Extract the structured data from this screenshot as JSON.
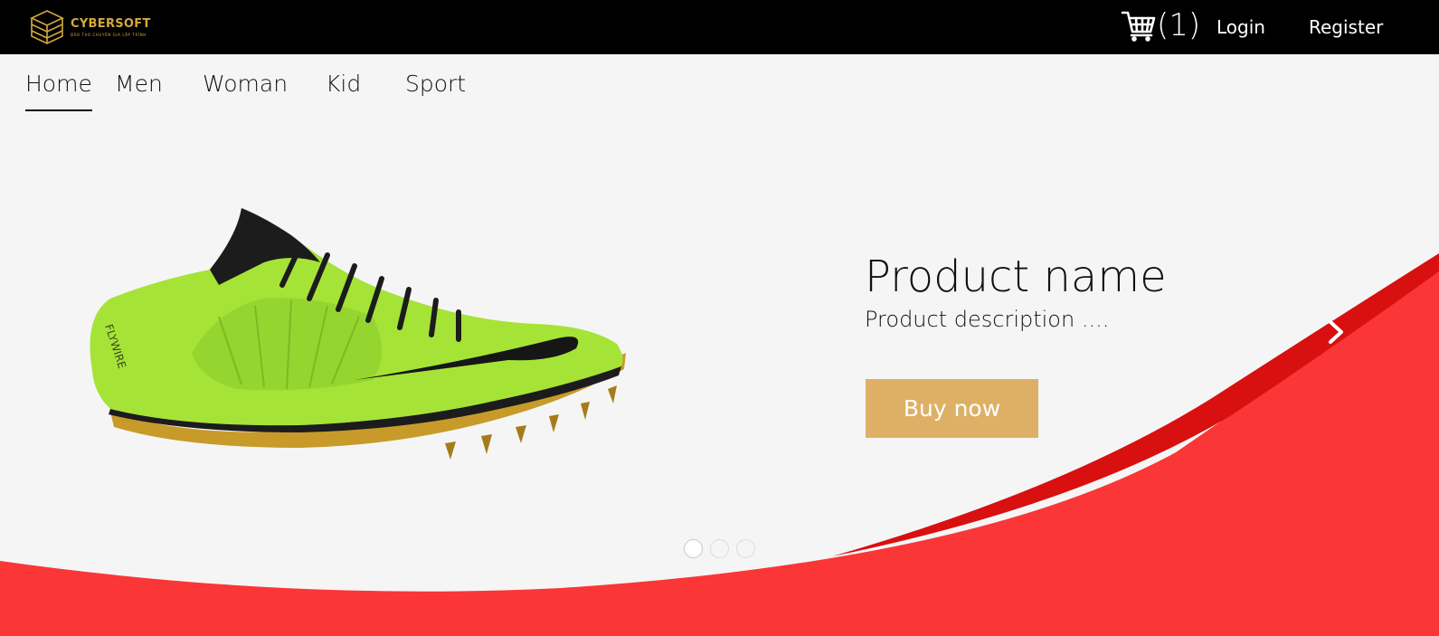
{
  "header": {
    "brand": "CYBERSOFT",
    "tagline": "ĐÀO TẠO CHUYÊN GIA LẬP TRÌNH",
    "cart_count": "(1)",
    "login_label": "Login",
    "register_label": "Register"
  },
  "nav": {
    "items": [
      {
        "label": "Home",
        "active": true
      },
      {
        "label": "Men"
      },
      {
        "label": "Woman"
      },
      {
        "label": "Kid"
      },
      {
        "label": "Sport"
      }
    ]
  },
  "carousel": {
    "product_name": "Product name",
    "product_description": "Product description ....",
    "buy_label": "Buy now",
    "active_slide": 1,
    "slide_count": 3,
    "shoe_text": "FLYWIRE"
  },
  "colors": {
    "header_bg": "#000000",
    "page_bg": "#f5f5f5",
    "accent_red": "#fa3636",
    "button_gold": "#deb066",
    "brand_gold": "#d4a93b",
    "shoe_green": "#a6e337"
  }
}
